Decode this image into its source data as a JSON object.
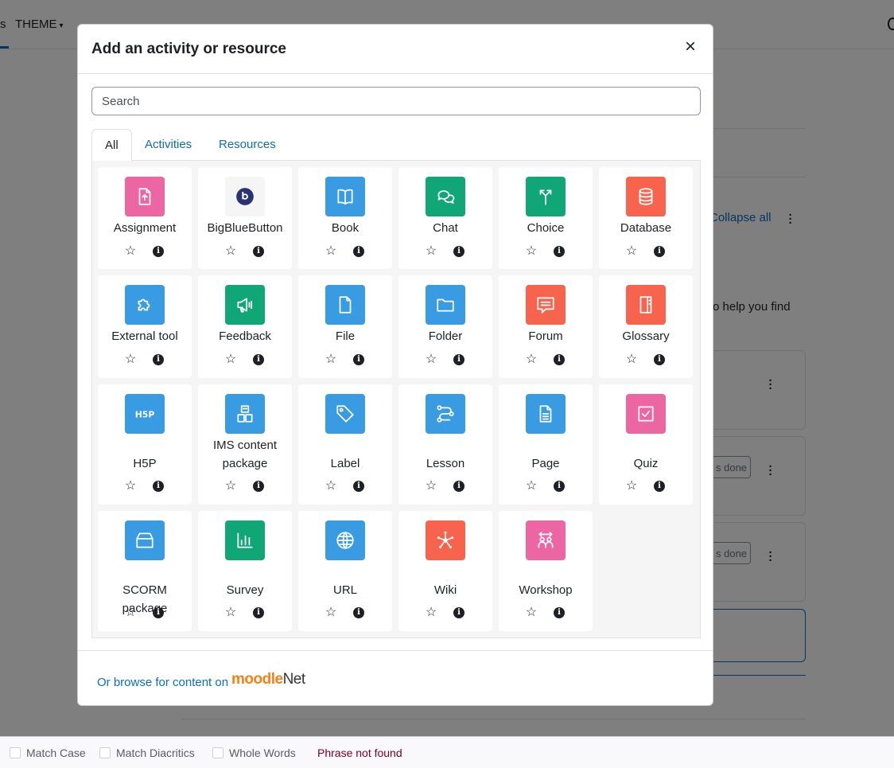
{
  "background": {
    "nav_fragment": "s",
    "theme_menu": "THEME",
    "collapse_all": "Collapse all",
    "help_fragment": "o help you find",
    "mark_done_1": "s done",
    "mark_done_2": "s done"
  },
  "modal": {
    "title": "Add an activity or resource",
    "close_symbol": "×",
    "search_placeholder": "Search",
    "tabs": [
      {
        "label": "All",
        "active": true
      },
      {
        "label": "Activities",
        "active": false
      },
      {
        "label": "Resources",
        "active": false
      }
    ],
    "items": [
      {
        "name": "Assignment",
        "icon": "assignment-icon",
        "color": "#eb66a2"
      },
      {
        "name": "BigBlueButton",
        "icon": "bigbluebutton-icon",
        "color": "#f5f5f5"
      },
      {
        "name": "Book",
        "icon": "book-icon",
        "color": "#399be2"
      },
      {
        "name": "Chat",
        "icon": "chat-icon",
        "color": "#11a676"
      },
      {
        "name": "Choice",
        "icon": "choice-icon",
        "color": "#11a676"
      },
      {
        "name": "Database",
        "icon": "database-icon",
        "color": "#f7634d"
      },
      {
        "name": "External tool",
        "icon": "puzzle-icon",
        "color": "#399be2"
      },
      {
        "name": "Feedback",
        "icon": "megaphone-icon",
        "color": "#11a676"
      },
      {
        "name": "File",
        "icon": "file-icon",
        "color": "#399be2"
      },
      {
        "name": "Folder",
        "icon": "folder-icon",
        "color": "#399be2"
      },
      {
        "name": "Forum",
        "icon": "forum-icon",
        "color": "#f7634d"
      },
      {
        "name": "Glossary",
        "icon": "glossary-icon",
        "color": "#f7634d"
      },
      {
        "name": "H5P",
        "icon": "h5p-icon",
        "color": "#399be2"
      },
      {
        "name": "IMS content package",
        "icon": "ims-package-icon",
        "color": "#399be2"
      },
      {
        "name": "Label",
        "icon": "tag-icon",
        "color": "#399be2"
      },
      {
        "name": "Lesson",
        "icon": "lesson-icon",
        "color": "#399be2"
      },
      {
        "name": "Page",
        "icon": "page-icon",
        "color": "#399be2"
      },
      {
        "name": "Quiz",
        "icon": "quiz-icon",
        "color": "#eb66a2"
      },
      {
        "name": "SCORM package",
        "icon": "scorm-icon",
        "color": "#399be2"
      },
      {
        "name": "Survey",
        "icon": "survey-icon",
        "color": "#11a676"
      },
      {
        "name": "URL",
        "icon": "globe-icon",
        "color": "#399be2"
      },
      {
        "name": "Wiki",
        "icon": "wiki-icon",
        "color": "#f7634d"
      },
      {
        "name": "Workshop",
        "icon": "workshop-icon",
        "color": "#eb66a2"
      }
    ],
    "footer_link": "Or browse for content on",
    "moodlenet_logo": {
      "moodle": "moodle",
      "net": "Net"
    }
  },
  "findbar": {
    "match_case": "Match Case",
    "match_diacritics": "Match Diacritics",
    "whole_words": "Whole Words",
    "status": "Phrase not found"
  }
}
